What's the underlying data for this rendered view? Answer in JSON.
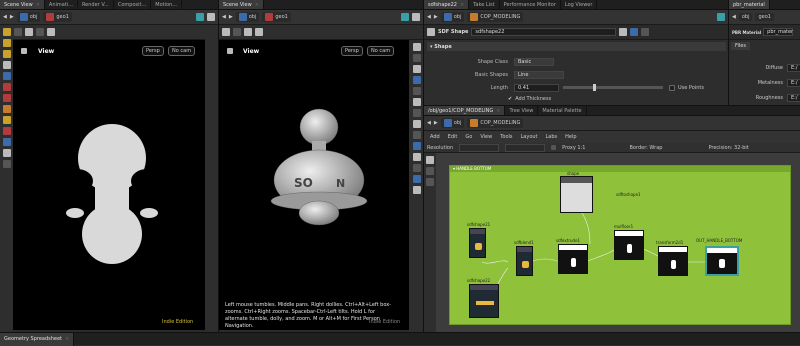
{
  "left_pane": {
    "tabs": [
      {
        "label": "Scene View",
        "active": true
      },
      {
        "label": "Animati..."
      },
      {
        "label": "Render V..."
      },
      {
        "label": "Composit..."
      },
      {
        "label": "Motion..."
      }
    ],
    "path": [
      "obj",
      "geo1"
    ],
    "view_label": "View",
    "persp_btn": "Persp",
    "cam_btn": "No cam",
    "edition": "Indie Edition"
  },
  "mid_pane": {
    "tabs": [
      {
        "label": "Scene View",
        "active": true
      }
    ],
    "path": [
      "obj",
      "geo1"
    ],
    "view_label": "View",
    "persp_btn": "Persp",
    "cam_btn": "No cam",
    "help_text": "Left mouse tumbles. Middle pans. Right dollies. Ctrl+Alt+Left box-zooms. Ctrl+Right zooms. Spacebar-Ctrl-Left tilts. Hold L for alternate tumble, dolly, and zoom.  M or Alt+M for First Person Navigation.",
    "edition": "Indie Edition"
  },
  "param_pane": {
    "tabs": [
      {
        "label": "sdfshape22",
        "active": true
      },
      {
        "label": "Take List"
      },
      {
        "label": "Performance Monitor"
      },
      {
        "label": "Log Viewer"
      }
    ],
    "path": [
      "obj",
      "COP_MODELING"
    ],
    "node_type": "SDF Shape",
    "node_name": "sdfshape22",
    "section": "Shape",
    "rows": [
      {
        "label": "Shape Class",
        "value": "Basic"
      },
      {
        "label": "Basic Shapes",
        "value": "Line"
      },
      {
        "label": "Length",
        "value": "0.41"
      }
    ],
    "use_points": "Use Points",
    "add_thickness": "Add Thickness"
  },
  "material_pane": {
    "tab": "pbr_material",
    "path": [
      "obj",
      "geo1"
    ],
    "type": "PBR Material",
    "name": "pbr_mater",
    "files_tab": "Files",
    "rows": [
      {
        "label": "Diffuse",
        "value": "E:/"
      },
      {
        "label": "Metalness",
        "value": "E:/"
      },
      {
        "label": "Roughness",
        "value": "E:/"
      }
    ]
  },
  "network_pane": {
    "tabs": [
      {
        "label": "/obj/geo1/COP_MODELING",
        "active": true
      },
      {
        "label": "Tree View"
      },
      {
        "label": "Material Palette"
      }
    ],
    "path": [
      "obj",
      "COP_MODELING"
    ],
    "menu": [
      "Add",
      "Edit",
      "Go",
      "View",
      "Tools",
      "Layout",
      "Labs",
      "Help"
    ],
    "resolution_label": "Resolution",
    "proxy": "Proxy 1:1",
    "border": "Border: Wrap",
    "precision": "Precision: 32-bit",
    "box_label": "HANDLE BOTTOM",
    "nodes": [
      {
        "label": "shape"
      },
      {
        "label": "sdfshape21"
      },
      {
        "label": "sdfblend1"
      },
      {
        "label": "sdfextrude1"
      },
      {
        "label": "mulfloor1"
      },
      {
        "label": "sdftoshape1"
      },
      {
        "label": "transform2d1"
      },
      {
        "label": "OUT_HANDLE_BOTTOM"
      },
      {
        "label": "sdfshape22"
      }
    ]
  },
  "bottom_tab": "Geometry Spreadsheet"
}
